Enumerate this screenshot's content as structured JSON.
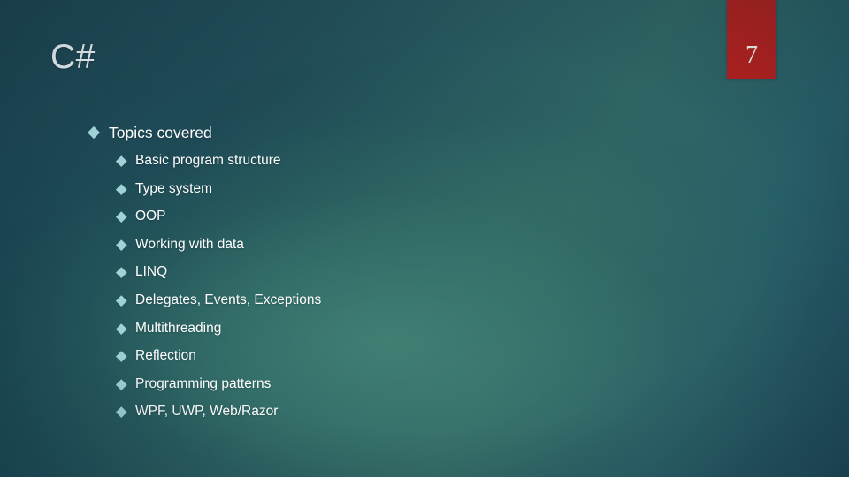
{
  "slide": {
    "title": "C#",
    "page_number": "7",
    "badge_color": "#b5201e",
    "text_color": "#ffffff",
    "bullet_color": "#a7d7dc",
    "background_dark": "#1a4552",
    "background_light": "#336b67"
  },
  "content": {
    "level1": {
      "label": "Topics covered"
    },
    "level2": [
      {
        "label": "Basic program structure"
      },
      {
        "label": "Type system"
      },
      {
        "label": "OOP"
      },
      {
        "label": "Working with data"
      },
      {
        "label": "LINQ"
      },
      {
        "label": "Delegates, Events, Exceptions"
      },
      {
        "label": "Multithreading"
      },
      {
        "label": "Reflection"
      },
      {
        "label": "Programming patterns"
      },
      {
        "label": "WPF, UWP, Web/Razor"
      }
    ]
  }
}
